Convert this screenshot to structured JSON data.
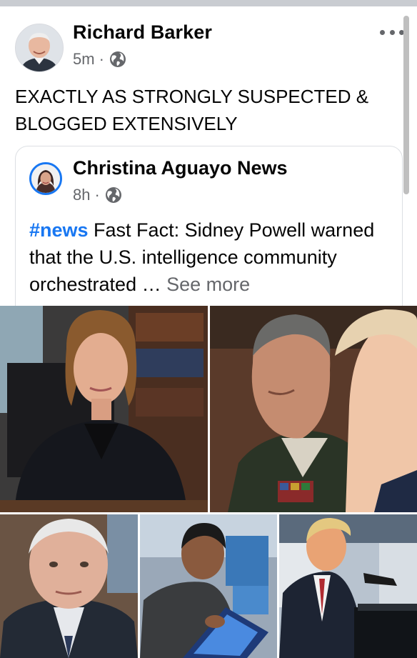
{
  "post": {
    "author": "Richard Barker",
    "time": "5m",
    "separator": "·",
    "audience_icon": "globe-icon",
    "text": "EXACTLY AS STRONGLY SUSPECTED & BLOGGED EXTENSIVELY",
    "more_icon": "more-options-icon"
  },
  "shared": {
    "author": "Christina Aguayo News",
    "time": "8h",
    "separator": "·",
    "audience_icon": "globe-icon",
    "hashtag": "#news",
    "text": " Fast Fact: Sidney Powell warned that the U.S. intelligence community orchestrated … ",
    "see_more": "See more"
  },
  "colors": {
    "link_blue": "#1877f2",
    "secondary_text": "#65676b",
    "divider": "#c9ccd1"
  }
}
